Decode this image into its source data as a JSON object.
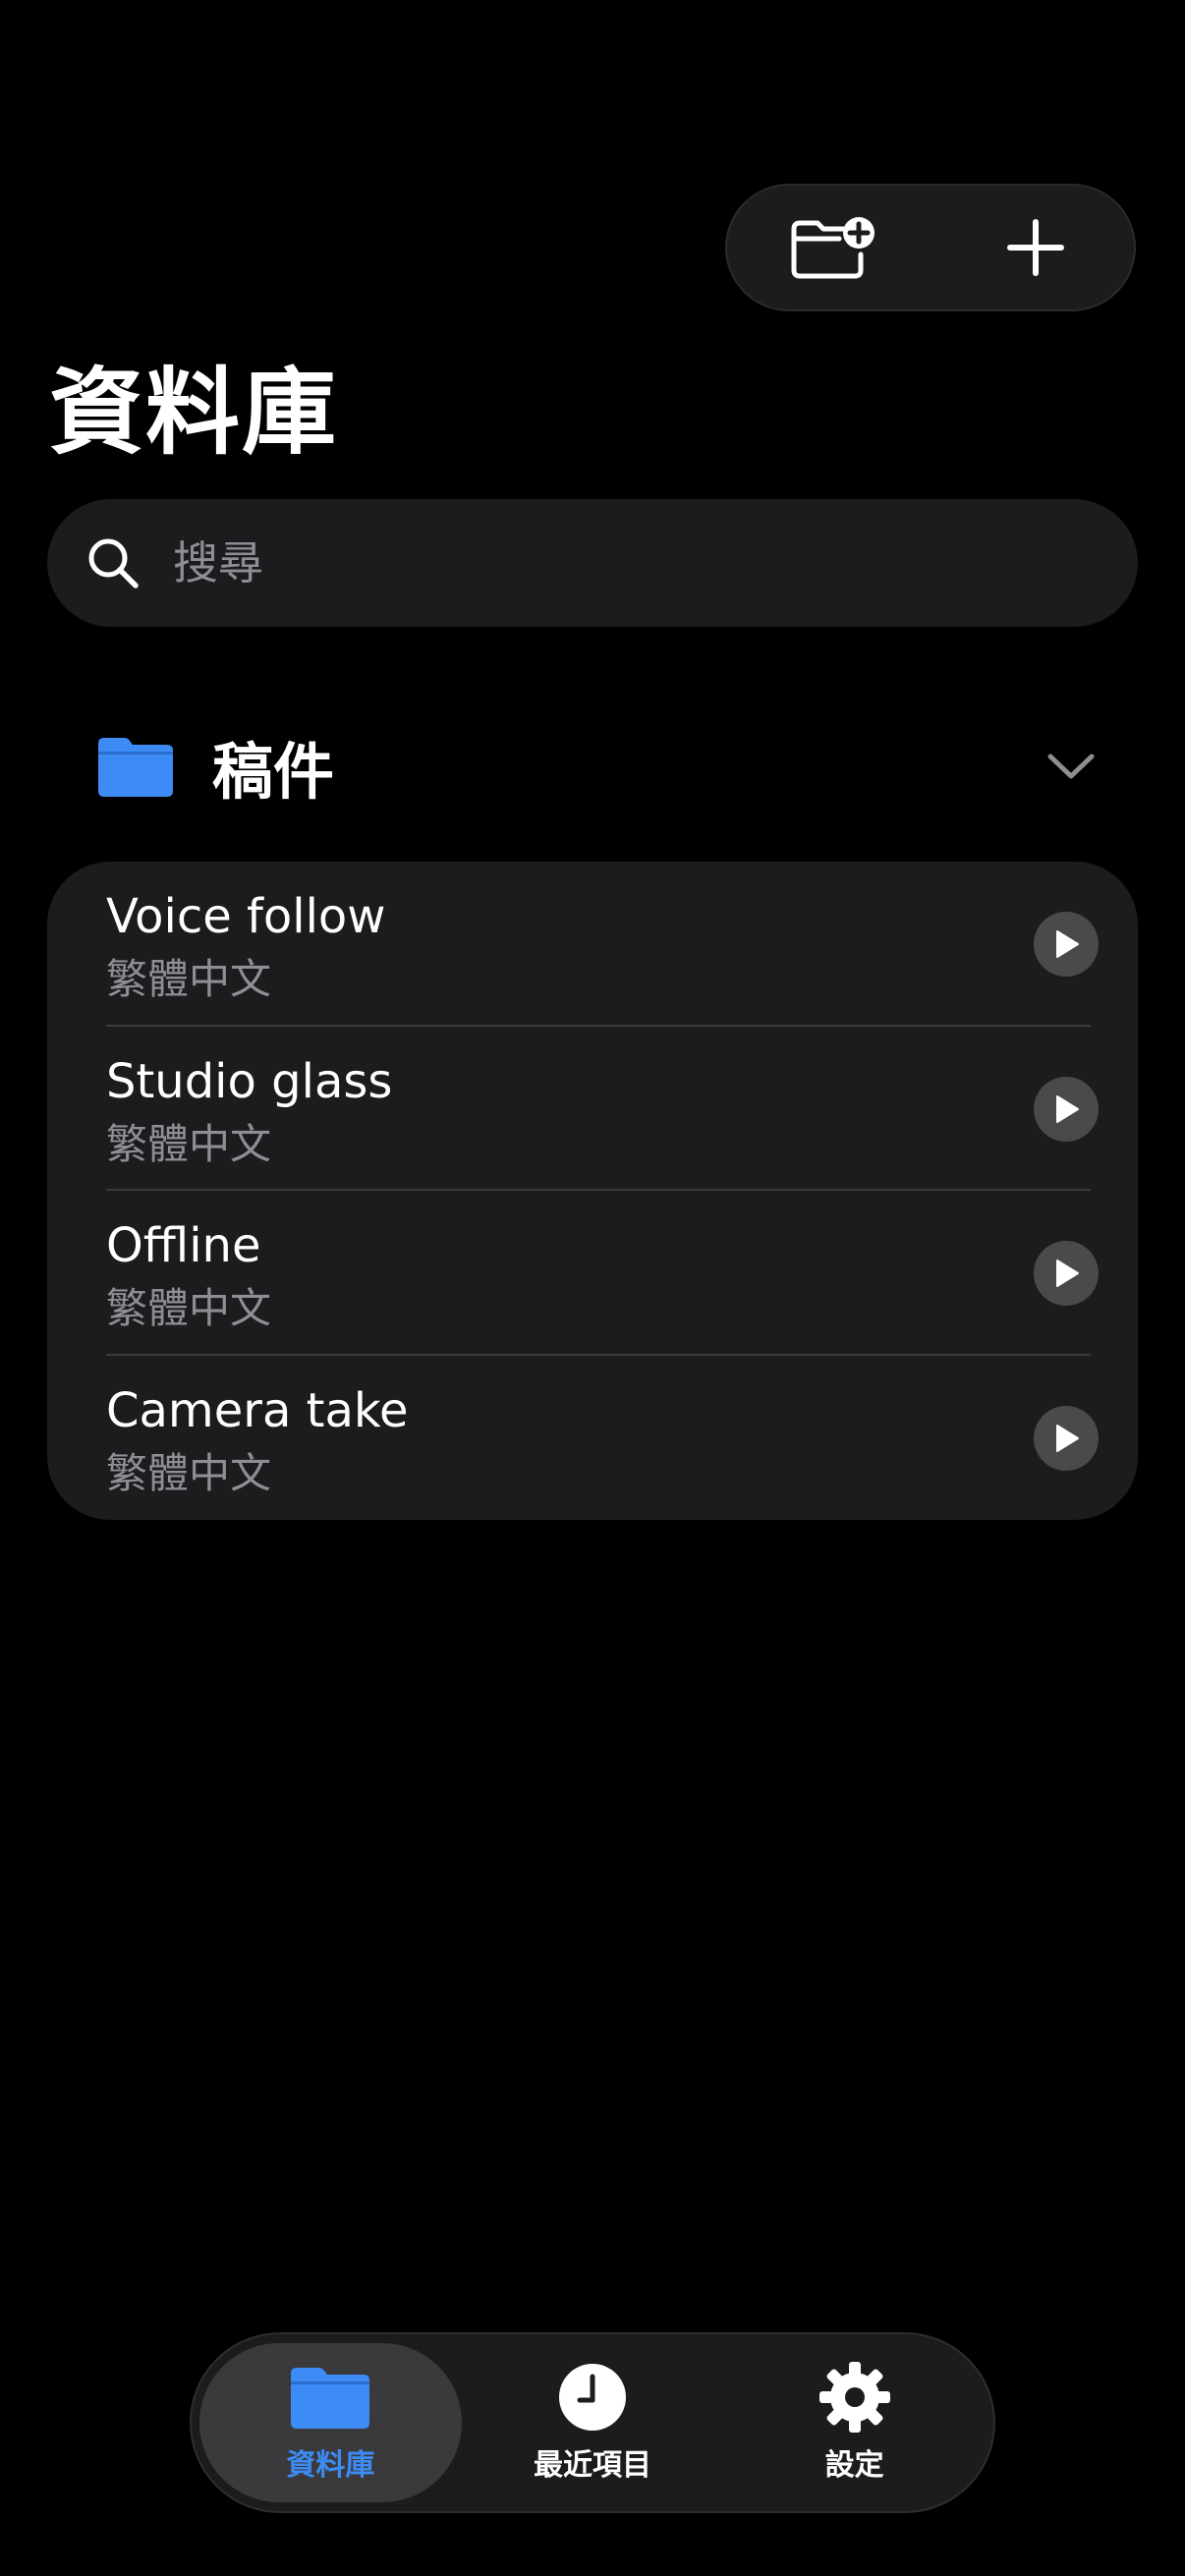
{
  "toolbar": {
    "new_folder_icon": "folder-plus-icon",
    "add_icon": "plus-icon"
  },
  "page": {
    "title": "資料庫"
  },
  "search": {
    "placeholder": "搜尋",
    "value": ""
  },
  "section": {
    "title": "稿件",
    "expanded": true
  },
  "items": [
    {
      "title": "Voice follow",
      "subtitle": "繁體中文"
    },
    {
      "title": "Studio glass",
      "subtitle": "繁體中文"
    },
    {
      "title": "Offline",
      "subtitle": "繁體中文"
    },
    {
      "title": "Camera take",
      "subtitle": "繁體中文"
    }
  ],
  "tabs": [
    {
      "label": "資料庫",
      "icon": "folder-icon",
      "active": true
    },
    {
      "label": "最近項目",
      "icon": "clock-icon",
      "active": false
    },
    {
      "label": "設定",
      "icon": "gear-icon",
      "active": false
    }
  ],
  "colors": {
    "accent": "#3d8bf5",
    "background": "#000000",
    "card": "#1c1c1e",
    "secondary_text": "#8e8e93"
  }
}
